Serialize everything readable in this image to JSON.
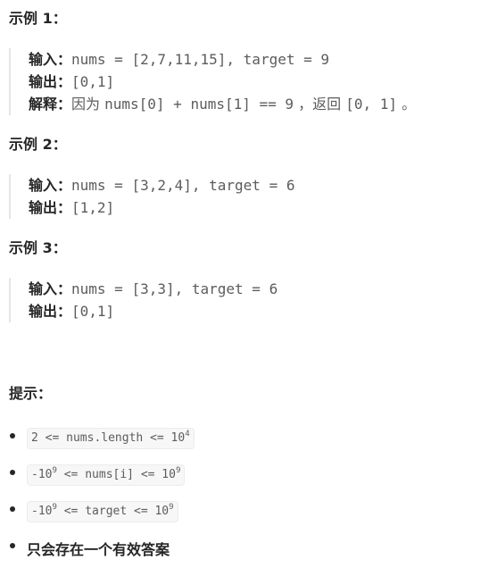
{
  "examples": [
    {
      "title": "示例 1：",
      "lines": [
        {
          "label": "输入：",
          "value": "nums = [2,7,11,15], target = 9"
        },
        {
          "label": "输出：",
          "value": "[0,1]"
        },
        {
          "label": "解释：",
          "prefix": "因为 ",
          "value": "nums[0] + nums[1] == 9",
          "mid": " ，返回 ",
          "value2": "[0, 1]",
          "suffix": " 。"
        }
      ]
    },
    {
      "title": "示例 2：",
      "lines": [
        {
          "label": "输入：",
          "value": "nums = [3,2,4], target = 6"
        },
        {
          "label": "输出：",
          "value": "[1,2]"
        }
      ]
    },
    {
      "title": "示例 3：",
      "lines": [
        {
          "label": "输入：",
          "value": "nums = [3,3], target = 6"
        },
        {
          "label": "输出：",
          "value": "[0,1]"
        }
      ]
    }
  ],
  "constraints_title": "提示：",
  "constraints": [
    {
      "pre": "",
      "base": "2 <= nums.length <= 10",
      "exp": "4"
    },
    {
      "pre": "-10",
      "pre_exp": "9",
      "base": " <= nums[i] <= 10",
      "exp": "9"
    },
    {
      "pre": "-10",
      "pre_exp": "9",
      "base": " <= target <= 10",
      "exp": "9"
    }
  ],
  "final_note": "只会存在一个有效答案"
}
